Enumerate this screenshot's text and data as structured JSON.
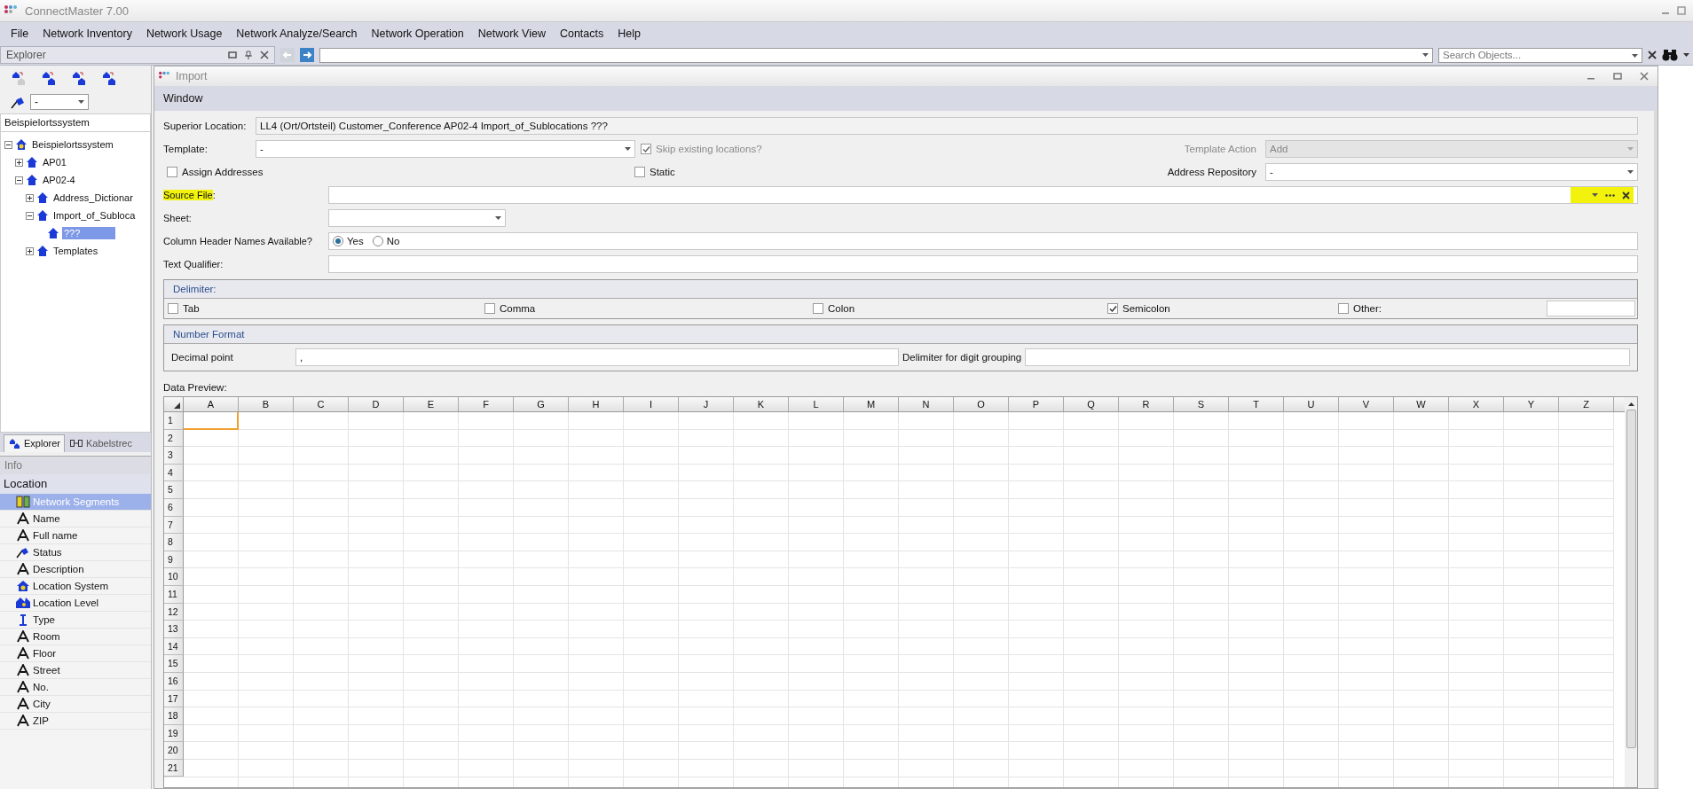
{
  "app_title": "ConnectMaster 7.00",
  "menu": [
    "File",
    "Network Inventory",
    "Network Usage",
    "Network Analyze/Search",
    "Network Operation",
    "Network View",
    "Contacts",
    "Help"
  ],
  "explorer": {
    "title": "Explorer",
    "filter_value": "-",
    "root_field": "Beispielortssystem",
    "tree": [
      {
        "label": "Beispielortssystem",
        "kind": "system",
        "expanded": true,
        "selected": false,
        "children": [
          {
            "label": "AP01",
            "kind": "location",
            "expanded": false,
            "selected": false
          },
          {
            "label": "AP02-4",
            "kind": "location",
            "expanded": true,
            "selected": false,
            "children": [
              {
                "label": "Address_Dictionar",
                "kind": "location",
                "expanded": false,
                "selected": false
              },
              {
                "label": "Import_of_Subloca",
                "kind": "location",
                "expanded": true,
                "selected": false,
                "children": [
                  {
                    "label": "???",
                    "kind": "location",
                    "selected": true
                  }
                ]
              },
              {
                "label": "Templates",
                "kind": "location",
                "expanded": false,
                "selected": false
              }
            ]
          }
        ]
      }
    ],
    "tabs": [
      {
        "label": "Explorer",
        "selected": true
      },
      {
        "label": "Kabelstrec",
        "selected": false
      }
    ]
  },
  "info": {
    "title": "Info",
    "heading": "Location",
    "items": [
      {
        "label": "Network Segments",
        "kind": "segments",
        "selected": true
      },
      {
        "label": "Name",
        "kind": "text",
        "selected": false
      },
      {
        "label": "Full name",
        "kind": "text",
        "selected": false
      },
      {
        "label": "Status",
        "kind": "status",
        "selected": false
      },
      {
        "label": "Description",
        "kind": "text",
        "selected": false
      },
      {
        "label": "Location System",
        "kind": "system",
        "selected": false
      },
      {
        "label": "Location Level",
        "kind": "level",
        "selected": false
      },
      {
        "label": "Type",
        "kind": "type",
        "selected": false
      },
      {
        "label": "Room",
        "kind": "text",
        "selected": false
      },
      {
        "label": "Floor",
        "kind": "text",
        "selected": false
      },
      {
        "label": "Street",
        "kind": "text",
        "selected": false
      },
      {
        "label": "No.",
        "kind": "text",
        "selected": false
      },
      {
        "label": "City",
        "kind": "text",
        "selected": false
      },
      {
        "label": "ZIP",
        "kind": "text",
        "selected": false
      }
    ]
  },
  "search": {
    "placeholder": "Search Objects..."
  },
  "import": {
    "title": "Import",
    "section": "Window",
    "superior_location": {
      "label": "Superior Location:",
      "value": "LL4 (Ort/Ortsteil) Customer_Conference AP02-4 Import_of_Sublocations ???"
    },
    "template": {
      "label": "Template:",
      "value": "-"
    },
    "skip_existing": {
      "label": "Skip existing locations?",
      "checked": true,
      "disabled": true
    },
    "template_action": {
      "label": "Template Action",
      "value": "Add",
      "disabled": true
    },
    "assign_addresses": {
      "label": "Assign Addresses",
      "checked": false
    },
    "static": {
      "label": "Static",
      "checked": false
    },
    "address_repository": {
      "label": "Address Repository",
      "value": "-"
    },
    "source_file": {
      "label": "Source File",
      "label_suffix": ":",
      "highlighted": true
    },
    "sheet": {
      "label": "Sheet:"
    },
    "column_header": {
      "label": "Column Header Names Available?",
      "options": [
        {
          "label": "Yes",
          "selected": true
        },
        {
          "label": "No",
          "selected": false
        }
      ]
    },
    "text_qualifier": {
      "label": "Text Qualifier:"
    },
    "delimiter": {
      "title": "Delimiter:",
      "options": [
        {
          "label": "Tab",
          "checked": false
        },
        {
          "label": "Comma",
          "checked": false
        },
        {
          "label": "Colon",
          "checked": false
        },
        {
          "label": "Semicolon",
          "checked": true
        },
        {
          "label": "Other:",
          "checked": false
        }
      ]
    },
    "number_format": {
      "title": "Number Format",
      "decimal_label": "Decimal point",
      "decimal_value": ",",
      "grouping_label": "Delimiter for digit grouping"
    },
    "preview": {
      "label": "Data Preview:",
      "columns": [
        "A",
        "B",
        "C",
        "D",
        "E",
        "F",
        "G",
        "H",
        "I",
        "J",
        "K",
        "L",
        "M",
        "N",
        "O",
        "P",
        "Q",
        "R",
        "S",
        "T",
        "U",
        "V",
        "W",
        "X",
        "Y",
        "Z"
      ],
      "rows": [
        {
          "label": "1",
          "selected": true
        },
        {
          "label": "2",
          "selected": false
        },
        {
          "label": "3",
          "selected": false
        },
        {
          "label": "4",
          "selected": false
        },
        {
          "label": "5",
          "selected": false
        },
        {
          "label": "6",
          "selected": false
        },
        {
          "label": "7",
          "selected": false
        },
        {
          "label": "8",
          "selected": false
        },
        {
          "label": "9",
          "selected": false
        },
        {
          "label": "10",
          "selected": false
        },
        {
          "label": "11",
          "selected": false
        },
        {
          "label": "12",
          "selected": false
        },
        {
          "label": "13",
          "selected": false
        },
        {
          "label": "14",
          "selected": false
        },
        {
          "label": "15",
          "selected": false
        },
        {
          "label": "16",
          "selected": false
        },
        {
          "label": "17",
          "selected": false
        },
        {
          "label": "18",
          "selected": false
        },
        {
          "label": "19",
          "selected": false
        },
        {
          "label": "20",
          "selected": false
        },
        {
          "label": "21",
          "selected": false
        }
      ]
    }
  }
}
